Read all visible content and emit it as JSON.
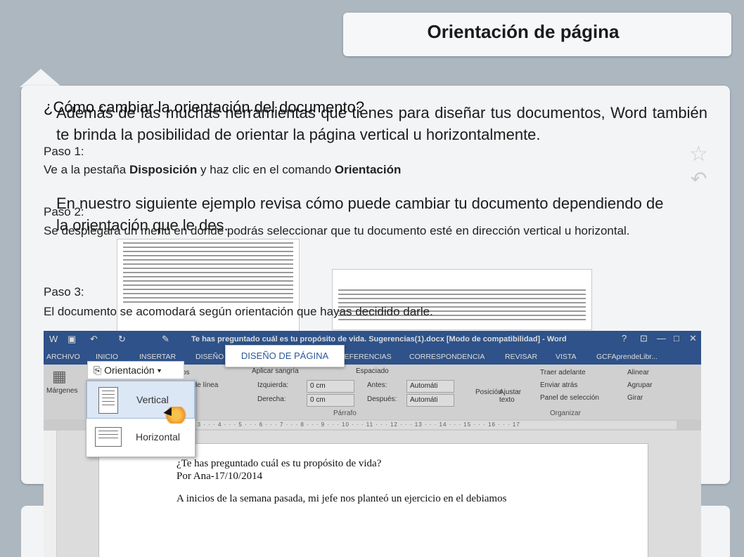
{
  "title": "Orientación de página",
  "intro": {
    "paragraph1": "Además de las muchas herramientas que tienes para diseñar tus documentos, Word también te brinda la posibilidad de orientar la página vertical u horizontalmente.",
    "paragraph2": "En nuestro siguiente ejemplo revisa cómo puede cambiar tu documento dependiendo de la orientación que le des."
  },
  "question": "¿Cómo cambiar la orientación del documento?",
  "steps": [
    {
      "label": "Paso 1:",
      "text_before": "Ve a la pestaña ",
      "bold1": "Disposición",
      "text_middle": " y haz clic en el comando ",
      "bold2": "Orientación"
    },
    {
      "label": "Paso 2:",
      "text": "Se desplegará un menú en donde podrás seleccionar que tu documento esté en dirección vertical u horizontal."
    },
    {
      "label": "Paso 3:",
      "text": "El documento se acomodará según orientación que hayas decidido darle."
    }
  ],
  "word": {
    "window_title": "Te has preguntado cuál es tu propósito de vida. Sugerencias(1).docx [Modo de compatibilidad] - Word",
    "account": "GCFAprendeLibr...",
    "tabs": [
      "ARCHIVO",
      "INICIO",
      "INSERTAR",
      "DISEÑO",
      "REFERENCIAS",
      "CORRESPONDENCIA",
      "REVISAR",
      "VISTA"
    ],
    "active_tab": "DISEÑO DE PÁGINA",
    "ribbon": {
      "margins": "Márgenes",
      "orientation_button": "Orientación",
      "line_numbers": "ros de línea",
      "hyphen": "ltos",
      "indent_header": "Aplicar sangría",
      "left_label": "Izquierda:",
      "left_value": "0 cm",
      "right_label": "Derecha:",
      "right_value": "0 cm",
      "spacing_header": "Espaciado",
      "before_label": "Antes:",
      "before_value": "Automáti",
      "after_label": "Después:",
      "after_value": "Automáti",
      "paragraph_group": "Párrafo",
      "position": "Posición",
      "wrap_text": "Ajustar texto",
      "bring_forward": "Traer adelante",
      "send_backward": "Enviar atrás",
      "selection_pane": "Panel de selección",
      "align": "Alinear",
      "group": "Agrupar",
      "rotate": "Girar",
      "arrange_group": "Organizar"
    },
    "menu": {
      "vertical": "Vertical",
      "horizontal": "Horizontal"
    },
    "ruler": "1 · · · 2 · · · 3 · · · 4 · · · 5 · · · 6 · · · 7 · · · 8 · · · 9 · · · 10 · · · 11 · · · 12 · · · 13 · · · 14 · · · 15 · · · 16 · · · 17",
    "doc_lines": [
      "¿Te has preguntado cuál es tu propósito de vida?",
      "Por Ana-17/10/2014",
      "A inicios de la semana pasada, mi jefe nos planteó un ejercicio en el debiamos"
    ]
  },
  "colors": {
    "word_blue": "#2b579a",
    "slide_bg": "#adb7c0",
    "card_bg": "#f3f4f5"
  }
}
